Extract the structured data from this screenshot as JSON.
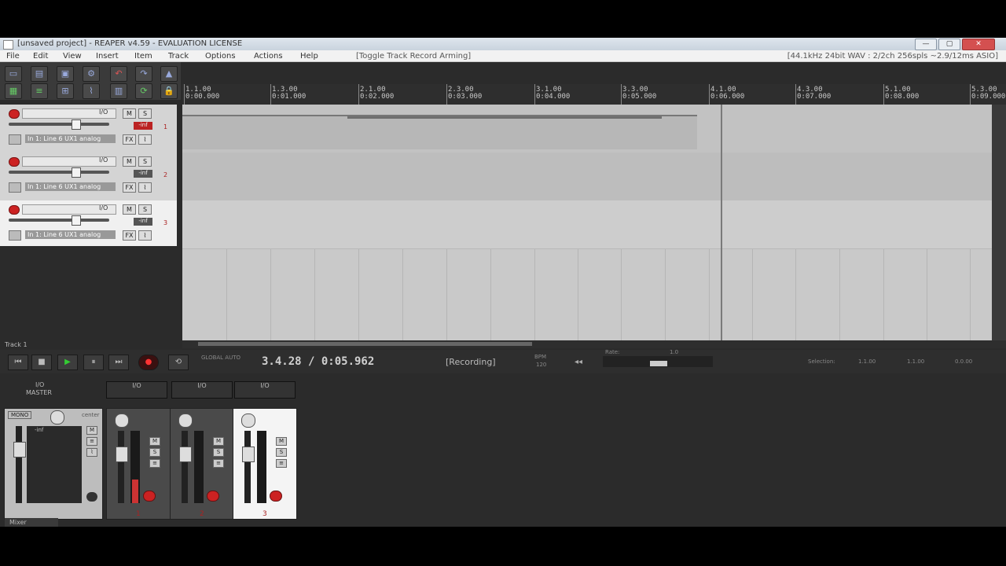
{
  "window": {
    "title": "[unsaved project] - REAPER v4.59 - EVALUATION LICENSE",
    "min_label": "—",
    "max_label": "▢",
    "close_label": "✕"
  },
  "menu": {
    "items": [
      "File",
      "Edit",
      "View",
      "Insert",
      "Item",
      "Track",
      "Options",
      "Actions",
      "Help"
    ],
    "status": "[Toggle Track Record Arming]",
    "format": "[44.1kHz 24bit WAV : 2/2ch 256spls ~2.9/12ms ASIO]"
  },
  "ruler": {
    "marks": [
      {
        "bar": "1.1.00",
        "time": "0:00.000"
      },
      {
        "bar": "1.3.00",
        "time": "0:01.000"
      },
      {
        "bar": "2.1.00",
        "time": "0:02.000"
      },
      {
        "bar": "2.3.00",
        "time": "0:03.000"
      },
      {
        "bar": "3.1.00",
        "time": "0:04.000"
      },
      {
        "bar": "3.3.00",
        "time": "0:05.000"
      },
      {
        "bar": "4.1.00",
        "time": "0:06.000"
      },
      {
        "bar": "4.3.00",
        "time": "0:07.000"
      },
      {
        "bar": "5.1.00",
        "time": "0:08.000"
      },
      {
        "bar": "5.3.00",
        "time": "0:09.000"
      }
    ]
  },
  "tracks": [
    {
      "number": "1",
      "vol": "-inf",
      "input": "In 1: Line 6 UX1 analog",
      "mute": "M",
      "solo": "S",
      "fx": "FX",
      "io": "I/O"
    },
    {
      "number": "2",
      "vol": "-inf",
      "input": "In 1: Line 6 UX1 analog",
      "mute": "M",
      "solo": "S",
      "fx": "FX",
      "io": "I/O"
    },
    {
      "number": "3",
      "vol": "-inf",
      "input": "In 1: Line 6 UX1 analog",
      "mute": "M",
      "solo": "S",
      "fx": "FX",
      "io": "I/O"
    }
  ],
  "arrange": {
    "track_label": "Track 1"
  },
  "transport": {
    "time": "3.4.28 / 0:05.962",
    "status": "[Recording]",
    "global": "GLOBAL AUTO",
    "bpm_label": "BPM",
    "bpm": "120",
    "timesig": "4/4",
    "rate_label": "Rate:",
    "rate": "1.0",
    "selection_label": "Selection:",
    "sel_start": "1.1.00",
    "sel_end": "1.1.00",
    "sel_len": "0.0.00"
  },
  "mixer": {
    "master_label": "MASTER",
    "master_io": "I/O",
    "mono": "MONO",
    "center": "center",
    "channels": [
      {
        "number": "1",
        "io": "I/O"
      },
      {
        "number": "2",
        "io": "I/O"
      },
      {
        "number": "3",
        "io": "I/O"
      }
    ],
    "label": "Mixer",
    "master_db": "-inf"
  },
  "colors": {
    "record": "#cc2222",
    "play": "#33cc33",
    "selected_track": "#f0f0f0"
  }
}
